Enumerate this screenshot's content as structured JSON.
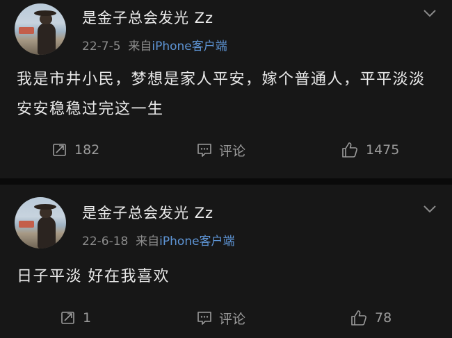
{
  "posts": [
    {
      "author": "是金子总会发光 Zz",
      "date": "22-7-5",
      "from_label": "来自",
      "client": "iPhone客户端",
      "text": "我是市井小民，梦想是家人平安，嫁个普通人，平平淡淡安安稳稳过完这一生",
      "reposts": "182",
      "comment_label": "评论",
      "likes": "1475"
    },
    {
      "author": "是金子总会发光 Zz",
      "date": "22-6-18",
      "from_label": "来自",
      "client": "iPhone客户端",
      "text": "日子平淡 好在我喜欢",
      "reposts": "1",
      "comment_label": "评论",
      "likes": "78"
    }
  ],
  "icons": {
    "repost": "repost-icon",
    "comment": "comment-icon",
    "like": "thumbs-up-icon",
    "menu": "chevron-down-icon"
  },
  "colors": {
    "background": "#171717",
    "client_link": "#5e95d6",
    "secondary_text": "#8c8c8c"
  }
}
